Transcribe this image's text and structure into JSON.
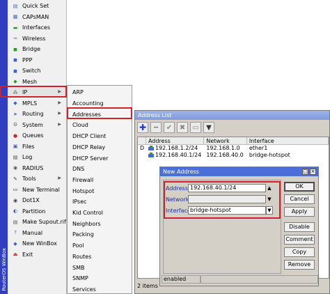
{
  "sidebar": {
    "strip_text": "RouterOS WinBox",
    "items": [
      {
        "label": "Quick Set",
        "icon": "quick-set-icon",
        "has_submenu": false
      },
      {
        "label": "CAPsMAN",
        "icon": "capsman-icon",
        "has_submenu": false
      },
      {
        "label": "Interfaces",
        "icon": "interfaces-icon",
        "has_submenu": false
      },
      {
        "label": "Wireless",
        "icon": "wireless-icon",
        "has_submenu": false
      },
      {
        "label": "Bridge",
        "icon": "bridge-icon",
        "has_submenu": false
      },
      {
        "label": "PPP",
        "icon": "ppp-icon",
        "has_submenu": false
      },
      {
        "label": "Switch",
        "icon": "switch-icon",
        "has_submenu": false
      },
      {
        "label": "Mesh",
        "icon": "mesh-icon",
        "has_submenu": false
      },
      {
        "label": "IP",
        "icon": "ip-icon",
        "has_submenu": true
      },
      {
        "label": "MPLS",
        "icon": "mpls-icon",
        "has_submenu": true
      },
      {
        "label": "Routing",
        "icon": "routing-icon",
        "has_submenu": true
      },
      {
        "label": "System",
        "icon": "system-icon",
        "has_submenu": true
      },
      {
        "label": "Queues",
        "icon": "queues-icon",
        "has_submenu": false
      },
      {
        "label": "Files",
        "icon": "files-icon",
        "has_submenu": false
      },
      {
        "label": "Log",
        "icon": "log-icon",
        "has_submenu": false
      },
      {
        "label": "RADIUS",
        "icon": "radius-icon",
        "has_submenu": false
      },
      {
        "label": "Tools",
        "icon": "tools-icon",
        "has_submenu": true
      },
      {
        "label": "New Terminal",
        "icon": "terminal-icon",
        "has_submenu": false
      },
      {
        "label": "Dot1X",
        "icon": "dot1x-icon",
        "has_submenu": false
      },
      {
        "label": "Partition",
        "icon": "partition-icon",
        "has_submenu": false
      },
      {
        "label": "Make Supout.rif",
        "icon": "supout-icon",
        "has_submenu": false
      },
      {
        "label": "Manual",
        "icon": "manual-icon",
        "has_submenu": false
      },
      {
        "label": "New WinBox",
        "icon": "winbox-icon",
        "has_submenu": false
      },
      {
        "label": "Exit",
        "icon": "exit-icon",
        "has_submenu": false
      }
    ]
  },
  "ip_submenu": {
    "items": [
      "ARP",
      "Accounting",
      "Addresses",
      "Cloud",
      "DHCP Client",
      "DHCP Relay",
      "DHCP Server",
      "DNS",
      "Firewall",
      "Hotspot",
      "IPsec",
      "Kid Control",
      "Neighbors",
      "Packing",
      "Pool",
      "Routes",
      "SMB",
      "SNMP",
      "Services"
    ],
    "selected": "Addresses"
  },
  "address_list": {
    "title": "Address List",
    "columns": [
      "",
      "Address",
      "Network",
      "Interface"
    ],
    "rows": [
      {
        "flag": "D",
        "address": "192.168.1.2/24",
        "network": "192.168.1.0",
        "interface": "ether1"
      },
      {
        "flag": "",
        "address": "192.168.40.1/24",
        "network": "192.168.40.0",
        "interface": "bridge-hotspot"
      }
    ],
    "items_count": "2 items"
  },
  "new_address": {
    "title": "New Address",
    "address_label": "Address:",
    "address_value": "192.168.40.1/24",
    "network_label": "Network:",
    "network_value": "",
    "interface_label": "Interface:",
    "interface_value": "bridge-hotspot",
    "buttons": [
      "OK",
      "Cancel",
      "Apply",
      "Disable",
      "Comment",
      "Copy",
      "Remove"
    ],
    "status": "enabled"
  },
  "colors": {
    "accent_red": "#d0202a",
    "strip_blue": "#2f3fbf",
    "label_blue": "#1b2fa0"
  }
}
